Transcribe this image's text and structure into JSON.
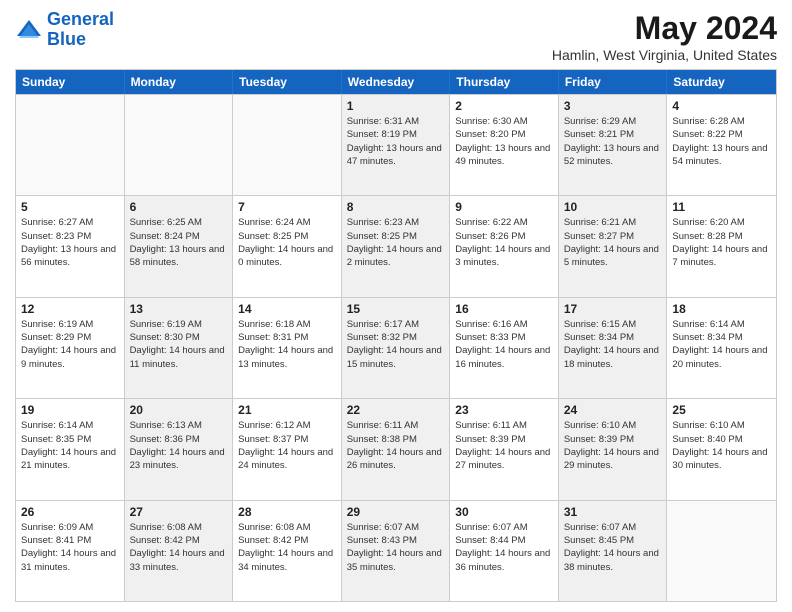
{
  "header": {
    "logo_line1": "General",
    "logo_line2": "Blue",
    "title": "May 2024",
    "subtitle": "Hamlin, West Virginia, United States"
  },
  "days_of_week": [
    "Sunday",
    "Monday",
    "Tuesday",
    "Wednesday",
    "Thursday",
    "Friday",
    "Saturday"
  ],
  "rows": [
    [
      {
        "num": "",
        "info": "",
        "empty": true
      },
      {
        "num": "",
        "info": "",
        "empty": true
      },
      {
        "num": "",
        "info": "",
        "empty": true
      },
      {
        "num": "1",
        "info": "Sunrise: 6:31 AM\nSunset: 8:19 PM\nDaylight: 13 hours\nand 47 minutes.",
        "shaded": true
      },
      {
        "num": "2",
        "info": "Sunrise: 6:30 AM\nSunset: 8:20 PM\nDaylight: 13 hours\nand 49 minutes.",
        "shaded": false
      },
      {
        "num": "3",
        "info": "Sunrise: 6:29 AM\nSunset: 8:21 PM\nDaylight: 13 hours\nand 52 minutes.",
        "shaded": true
      },
      {
        "num": "4",
        "info": "Sunrise: 6:28 AM\nSunset: 8:22 PM\nDaylight: 13 hours\nand 54 minutes.",
        "shaded": false
      }
    ],
    [
      {
        "num": "5",
        "info": "Sunrise: 6:27 AM\nSunset: 8:23 PM\nDaylight: 13 hours\nand 56 minutes.",
        "shaded": false
      },
      {
        "num": "6",
        "info": "Sunrise: 6:25 AM\nSunset: 8:24 PM\nDaylight: 13 hours\nand 58 minutes.",
        "shaded": true
      },
      {
        "num": "7",
        "info": "Sunrise: 6:24 AM\nSunset: 8:25 PM\nDaylight: 14 hours\nand 0 minutes.",
        "shaded": false
      },
      {
        "num": "8",
        "info": "Sunrise: 6:23 AM\nSunset: 8:25 PM\nDaylight: 14 hours\nand 2 minutes.",
        "shaded": true
      },
      {
        "num": "9",
        "info": "Sunrise: 6:22 AM\nSunset: 8:26 PM\nDaylight: 14 hours\nand 3 minutes.",
        "shaded": false
      },
      {
        "num": "10",
        "info": "Sunrise: 6:21 AM\nSunset: 8:27 PM\nDaylight: 14 hours\nand 5 minutes.",
        "shaded": true
      },
      {
        "num": "11",
        "info": "Sunrise: 6:20 AM\nSunset: 8:28 PM\nDaylight: 14 hours\nand 7 minutes.",
        "shaded": false
      }
    ],
    [
      {
        "num": "12",
        "info": "Sunrise: 6:19 AM\nSunset: 8:29 PM\nDaylight: 14 hours\nand 9 minutes.",
        "shaded": false
      },
      {
        "num": "13",
        "info": "Sunrise: 6:19 AM\nSunset: 8:30 PM\nDaylight: 14 hours\nand 11 minutes.",
        "shaded": true
      },
      {
        "num": "14",
        "info": "Sunrise: 6:18 AM\nSunset: 8:31 PM\nDaylight: 14 hours\nand 13 minutes.",
        "shaded": false
      },
      {
        "num": "15",
        "info": "Sunrise: 6:17 AM\nSunset: 8:32 PM\nDaylight: 14 hours\nand 15 minutes.",
        "shaded": true
      },
      {
        "num": "16",
        "info": "Sunrise: 6:16 AM\nSunset: 8:33 PM\nDaylight: 14 hours\nand 16 minutes.",
        "shaded": false
      },
      {
        "num": "17",
        "info": "Sunrise: 6:15 AM\nSunset: 8:34 PM\nDaylight: 14 hours\nand 18 minutes.",
        "shaded": true
      },
      {
        "num": "18",
        "info": "Sunrise: 6:14 AM\nSunset: 8:34 PM\nDaylight: 14 hours\nand 20 minutes.",
        "shaded": false
      }
    ],
    [
      {
        "num": "19",
        "info": "Sunrise: 6:14 AM\nSunset: 8:35 PM\nDaylight: 14 hours\nand 21 minutes.",
        "shaded": false
      },
      {
        "num": "20",
        "info": "Sunrise: 6:13 AM\nSunset: 8:36 PM\nDaylight: 14 hours\nand 23 minutes.",
        "shaded": true
      },
      {
        "num": "21",
        "info": "Sunrise: 6:12 AM\nSunset: 8:37 PM\nDaylight: 14 hours\nand 24 minutes.",
        "shaded": false
      },
      {
        "num": "22",
        "info": "Sunrise: 6:11 AM\nSunset: 8:38 PM\nDaylight: 14 hours\nand 26 minutes.",
        "shaded": true
      },
      {
        "num": "23",
        "info": "Sunrise: 6:11 AM\nSunset: 8:39 PM\nDaylight: 14 hours\nand 27 minutes.",
        "shaded": false
      },
      {
        "num": "24",
        "info": "Sunrise: 6:10 AM\nSunset: 8:39 PM\nDaylight: 14 hours\nand 29 minutes.",
        "shaded": true
      },
      {
        "num": "25",
        "info": "Sunrise: 6:10 AM\nSunset: 8:40 PM\nDaylight: 14 hours\nand 30 minutes.",
        "shaded": false
      }
    ],
    [
      {
        "num": "26",
        "info": "Sunrise: 6:09 AM\nSunset: 8:41 PM\nDaylight: 14 hours\nand 31 minutes.",
        "shaded": false
      },
      {
        "num": "27",
        "info": "Sunrise: 6:08 AM\nSunset: 8:42 PM\nDaylight: 14 hours\nand 33 minutes.",
        "shaded": true
      },
      {
        "num": "28",
        "info": "Sunrise: 6:08 AM\nSunset: 8:42 PM\nDaylight: 14 hours\nand 34 minutes.",
        "shaded": false
      },
      {
        "num": "29",
        "info": "Sunrise: 6:07 AM\nSunset: 8:43 PM\nDaylight: 14 hours\nand 35 minutes.",
        "shaded": true
      },
      {
        "num": "30",
        "info": "Sunrise: 6:07 AM\nSunset: 8:44 PM\nDaylight: 14 hours\nand 36 minutes.",
        "shaded": false
      },
      {
        "num": "31",
        "info": "Sunrise: 6:07 AM\nSunset: 8:45 PM\nDaylight: 14 hours\nand 38 minutes.",
        "shaded": true
      },
      {
        "num": "",
        "info": "",
        "empty": true
      }
    ]
  ]
}
